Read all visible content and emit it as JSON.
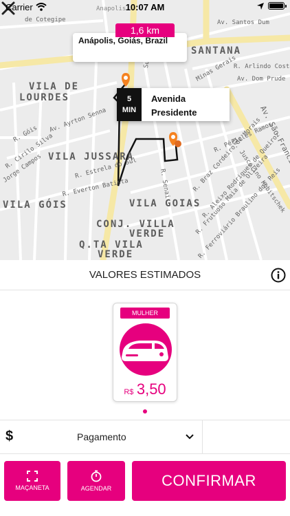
{
  "status_bar": {
    "carrier": "Carrier",
    "time": "10:07 AM"
  },
  "map": {
    "distance": "1,6 km",
    "origin": "Anápolis, Goiás, Brazil",
    "eta": {
      "value": "5",
      "unit": "MIN",
      "destination_line1": "Avenida",
      "destination_line2": "Presidente"
    },
    "labels": {
      "top_partial": "Anapolis",
      "de_cotegipe": "de Cotegipe",
      "av_santos_dumont": "Av. Santos Dum",
      "santana": "SANTANA",
      "vila_de": "VILA DE",
      "lourdes": "LOURDES",
      "r_arlindo_costa": "R. Arlindo Costa",
      "av_dom_prudente": "Av. Dom Prude",
      "av_ayrton_senna": "Av. Ayrton Senna",
      "vila_jussara": "VILA JUSSARA",
      "vila_gois": "VILA GÓIS",
      "vila_goias": "VILA GOIAS",
      "conj_villa": "CONJ. VILLA",
      "verde": "VERDE",
      "qta_vila": "Q.TA VILA",
      "verde2": "VERDE",
      "av_sao_francisco": "Av. São Francisco",
      "av_juscelino": "Av. Juscelino Kubitschek",
      "r_estrela_do_sul": "R. Estrela do Sul",
      "r_everton_batista": "R. Everton Batista",
      "r_cirilo_silva": "R. Cirilo Silva",
      "jorge_campos": "Jorge Campos",
      "r_gois": "R. Góis",
      "r_braz_cordeiro": "R. Braz Cordeiro de Morais",
      "r_aleixo_rodrigues": "R. Aleixo Rodrigues de Queiroz",
      "r_frutuoso_maia": "R. Frutuoso Maia de Oliveira",
      "r_ferroviario": "R. Ferroviário Braulino dos Reis",
      "r_pericles_ramos": "R. Péricles Ramos",
      "r_senai": "R. Senai",
      "minas_gerais": "Minas Gerais",
      "r_sul": "Sul"
    }
  },
  "estimate": {
    "title": "VALORES ESTIMADOS",
    "vehicle": {
      "tag": "MULHER",
      "currency": "R$",
      "price": "3,50"
    }
  },
  "payment": {
    "label": "Pagamento"
  },
  "actions": {
    "macaneta": "MAÇANETA",
    "agendar": "AGENDAR",
    "confirmar": "CONFIRMAR"
  },
  "colors": {
    "accent": "#e6007e",
    "map_bg": "#ececec",
    "main_road": "#f5e7a0"
  }
}
